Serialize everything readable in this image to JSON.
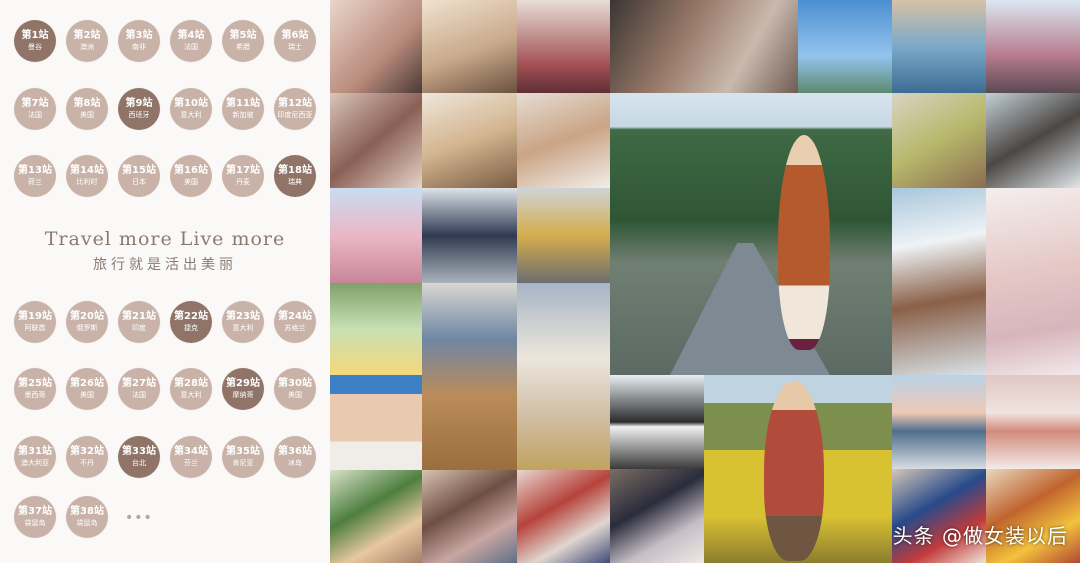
{
  "stops": [
    {
      "num": "第1站",
      "country": "曼谷",
      "shade": "dark"
    },
    {
      "num": "第2站",
      "country": "澳洲",
      "shade": "light"
    },
    {
      "num": "第3站",
      "country": "南非",
      "shade": "light"
    },
    {
      "num": "第4站",
      "country": "法国",
      "shade": "light"
    },
    {
      "num": "第5站",
      "country": "希腊",
      "shade": "light"
    },
    {
      "num": "第6站",
      "country": "瑞士",
      "shade": "light"
    },
    {
      "num": "第7站",
      "country": "法国",
      "shade": "light"
    },
    {
      "num": "第8站",
      "country": "美国",
      "shade": "light"
    },
    {
      "num": "第9站",
      "country": "西班牙",
      "shade": "dark"
    },
    {
      "num": "第10站",
      "country": "意大利",
      "shade": "light"
    },
    {
      "num": "第11站",
      "country": "新加坡",
      "shade": "light"
    },
    {
      "num": "第12站",
      "country": "印度尼西亚",
      "shade": "light"
    },
    {
      "num": "第13站",
      "country": "荷兰",
      "shade": "light"
    },
    {
      "num": "第14站",
      "country": "比利时",
      "shade": "light"
    },
    {
      "num": "第15站",
      "country": "日本",
      "shade": "light"
    },
    {
      "num": "第16站",
      "country": "美国",
      "shade": "light"
    },
    {
      "num": "第17站",
      "country": "丹麦",
      "shade": "light"
    },
    {
      "num": "第18站",
      "country": "瑞典",
      "shade": "dark"
    },
    {
      "num": "第19站",
      "country": "阿联酋",
      "shade": "light"
    },
    {
      "num": "第20站",
      "country": "俄罗斯",
      "shade": "light"
    },
    {
      "num": "第21站",
      "country": "印度",
      "shade": "light"
    },
    {
      "num": "第22站",
      "country": "捷克",
      "shade": "dark"
    },
    {
      "num": "第23站",
      "country": "意大利",
      "shade": "light"
    },
    {
      "num": "第24站",
      "country": "苏格兰",
      "shade": "light"
    },
    {
      "num": "第25站",
      "country": "墨西哥",
      "shade": "light"
    },
    {
      "num": "第26站",
      "country": "美国",
      "shade": "light"
    },
    {
      "num": "第27站",
      "country": "法国",
      "shade": "light"
    },
    {
      "num": "第28站",
      "country": "意大利",
      "shade": "light"
    },
    {
      "num": "第29站",
      "country": "摩纳哥",
      "shade": "dark"
    },
    {
      "num": "第30站",
      "country": "美国",
      "shade": "light"
    },
    {
      "num": "第31站",
      "country": "澳大利亚",
      "shade": "light"
    },
    {
      "num": "第32站",
      "country": "不丹",
      "shade": "light"
    },
    {
      "num": "第33站",
      "country": "台北",
      "shade": "dark"
    },
    {
      "num": "第34站",
      "country": "芬兰",
      "shade": "light"
    },
    {
      "num": "第35站",
      "country": "肯尼亚",
      "shade": "light"
    },
    {
      "num": "第36站",
      "country": "冰岛",
      "shade": "light"
    },
    {
      "num": "第37站",
      "country": "袋鼠岛",
      "shade": "light"
    },
    {
      "num": "第38站",
      "country": "袋鼠岛",
      "shade": "light"
    }
  ],
  "more": "•••",
  "slogan_en": "Travel more  Live more",
  "slogan_cn": "旅行就是活出美丽",
  "watermark": "头条 @做女装以后",
  "colors": {
    "dark_stop": "#8f7467",
    "light_stop": "#c9b3a8",
    "text": "#8a7a73"
  }
}
